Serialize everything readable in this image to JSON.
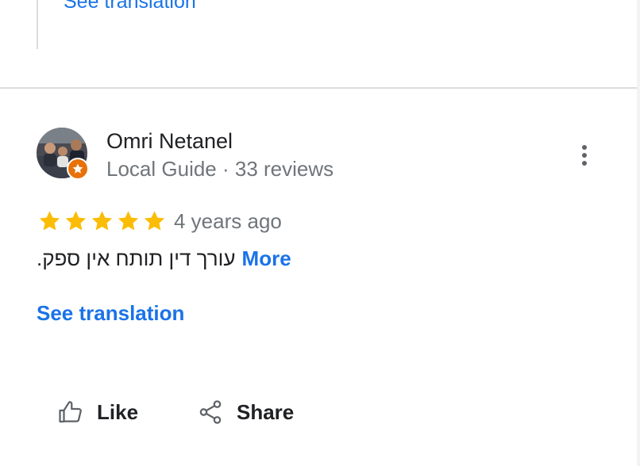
{
  "previous_review": {
    "see_translation_label": "See translation"
  },
  "review": {
    "author": {
      "name": "Omri Netanel",
      "meta": "Local Guide · 33 reviews",
      "avatar_icon": "user-photo",
      "badge_icon": "local-guide-star-icon",
      "badge_color": "#e8710a"
    },
    "menu_icon": "more-vert-icon",
    "rating": 5,
    "rating_max": 5,
    "star_color": "#fbbc04",
    "time": "4 years ago",
    "text": "עורך דין תותח אין ספק.",
    "more_label": "More",
    "see_translation_label": "See translation"
  },
  "actions": {
    "like": {
      "label": "Like",
      "icon": "thumb-up-outline-icon"
    },
    "share": {
      "label": "Share",
      "icon": "share-icon"
    }
  },
  "colors": {
    "link": "#1a73e8",
    "primary_text": "#202124",
    "secondary_text": "#70757a",
    "divider": "#dadce0"
  }
}
